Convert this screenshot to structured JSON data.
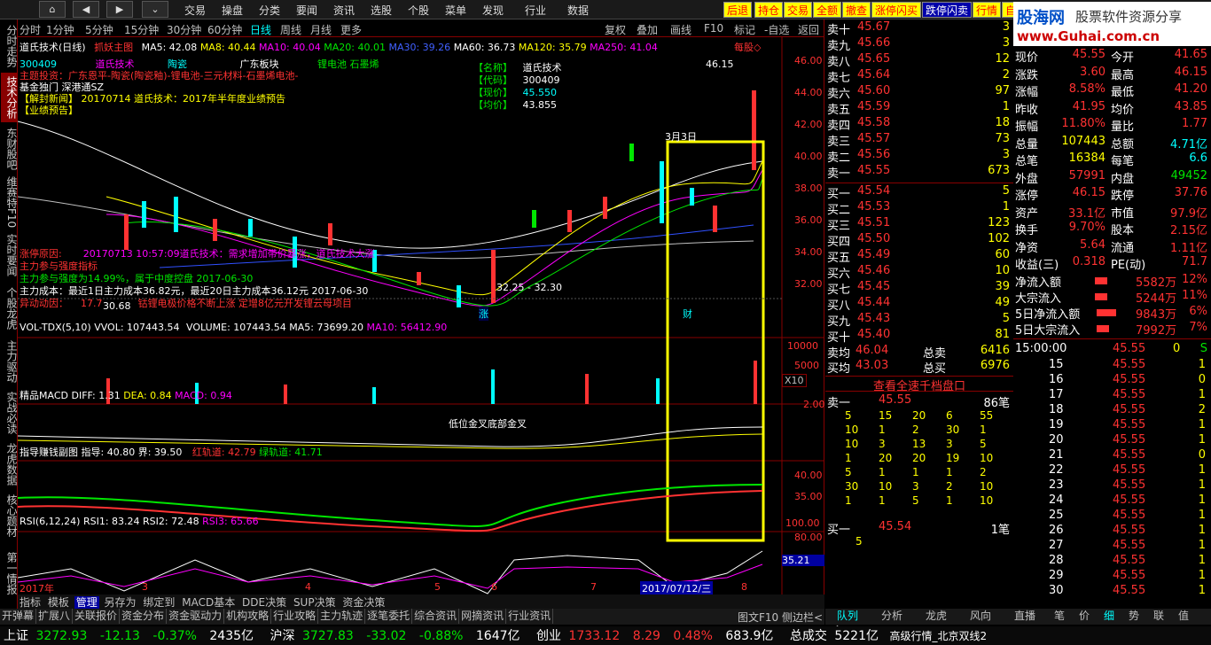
{
  "topbar": {
    "nav": [
      "⌂",
      "◀",
      "▶",
      "⌄"
    ],
    "menus": [
      "交易",
      "操盘",
      "分类",
      "要闻",
      "资讯",
      "选股",
      "个股",
      "菜单",
      "发现",
      "行业",
      "数据"
    ],
    "quick": [
      "后退",
      "持仓",
      "交易",
      "全额",
      "撤查",
      "涨停闪买",
      "跌停闪卖",
      "行情",
      "自"
    ]
  },
  "watermark": {
    "logo": "股海网",
    "slogan": "股票软件资源分享",
    "url": "www.Guhai.com.cn"
  },
  "lefttabs": [
    "分时走势",
    "技术分析",
    "东财股吧",
    "维赛特F10",
    "实时要闻",
    "个股龙虎",
    "主力驱动",
    "实战必读",
    "龙虎数据",
    "核心题材",
    "第一情报"
  ],
  "period": [
    "分时",
    "1分钟",
    "5分钟",
    "15分钟",
    "30分钟",
    "60分钟",
    "日线",
    "周线",
    "月线",
    "更多"
  ],
  "chart_toolbar": [
    "复权",
    "叠加",
    "画线",
    "F10",
    "标记",
    "-自选",
    "返回"
  ],
  "ma_line": {
    "name": "道氏技术(日线)",
    "tool": "抓妖主图",
    "ma5": "MA5: 42.08",
    "ma8": "MA8: 40.44",
    "ma10": "MA10: 40.04",
    "ma20": "MA20: 40.01",
    "ma30": "MA30: 39.26",
    "ma60": "MA60: 36.73",
    "ma120": "MA120: 35.79",
    "ma250": "MA250: 41.04",
    "right": "每股◇"
  },
  "info": {
    "code": "300409",
    "concept": "道氏技术",
    "c2": "陶瓷",
    "c3": "广东板块",
    "c4": "锂电池 石墨烯",
    "base": "基金独门 深港通SZ",
    "news": "【解封新闻】 20170714 道氏技术：2017年半年度业绩预告",
    "news2": "【业绩预告】",
    "l1": "主题投资：广东恩平-陶瓷(陶瓷釉)-锂电池-三元材料-石墨烯电池-"
  },
  "infobox": {
    "k1": "【名称】",
    "v1": "道氏技术",
    "k2": "【代码】",
    "v2": "300409",
    "k3": "【现价】",
    "v3": "45.550",
    "k4": "【均价】",
    "v4": "43.855"
  },
  "annot": {
    "high": "46.15",
    "date": "3月3日",
    "low": "32.25 - 32.30",
    "lowv": "30.68",
    "tag1": "涨",
    "tag2": "财",
    "reason": "涨停原因:",
    "reason2": "20170713 10:57:09道氏技术：需求增加带价暴涨，道氏技术大涨",
    "r3": "主力参与强度指标",
    "r4": "主力参与强度为14.99%，属于中度控盘 2017-06-30",
    "cost": "主力成本：",
    "cost2": "最近1日主力成本36.82元，最近20日主力成本36.12元 2017-06-30",
    "move": "异动动因：",
    "move2": "17.7",
    "move3": "钴锂电极价格不断上涨 定增8亿元开发锂云母项目"
  },
  "price_axis": [
    "46.00",
    "44.00",
    "42.00",
    "40.00",
    "38.00",
    "36.00",
    "34.00",
    "32.00"
  ],
  "vol": {
    "t": "VOL-TDX(5,10)",
    "a": "VVOL: 107443.54",
    "b": "VOLUME: 107443.54",
    "c": "MA5: 73699.20",
    "d": "MA10: 56412.90",
    "ax": [
      "10000",
      "5000"
    ],
    "x": "X10"
  },
  "macd": {
    "t": "精品MACD",
    "a": "DIFF: 1.31",
    "b": "DEA: 0.84",
    "c": "MACD: 0.94",
    "ax": "2.00",
    "note": "低位金叉底部金叉"
  },
  "zhidao": {
    "t": "指导赚钱副图",
    "a": "指导: 40.80",
    "b": "界: 39.50",
    "c": "红轨道: 42.79",
    "d": "绿轨道: 41.71",
    "ax": [
      "40.00",
      "35.00"
    ]
  },
  "rsi": {
    "t": "RSI(6,12,24)",
    "a": "RSI1: 83.24",
    "b": "RSI2: 72.48",
    "c": "RSI3: 65.66",
    "ax": [
      "100.00",
      "80.00"
    ],
    "cur": "35.21"
  },
  "months": [
    "2017年",
    "3",
    "4",
    "5",
    "6",
    "7",
    "8"
  ],
  "cursor_date": "2017/07/12/三",
  "bottom_tabs": [
    "指标",
    "模板",
    "管理",
    "另存为",
    "绑定到",
    "MACD基本",
    "DDE决策",
    "SUP决策",
    "资金决策"
  ],
  "bottom_tabs2": [
    "开弹幕",
    "扩展八",
    "关联报价",
    "资金分布",
    "资金驱动力",
    "机构攻略",
    "行业攻略",
    "主力轨迹",
    "逐笔委托",
    "综合资讯",
    "网摘资讯",
    "行业资讯"
  ],
  "bottom_right": [
    "图文F10",
    "侧边栏<"
  ],
  "right_tabs": [
    "队列",
    "分析",
    "龙虎",
    "风向",
    "直播",
    "笔",
    "价",
    "细",
    "势",
    "联",
    "值",
    "主"
  ],
  "asks": [
    [
      "卖十",
      "45.67",
      "3"
    ],
    [
      "卖九",
      "45.66",
      "3"
    ],
    [
      "卖八",
      "45.65",
      "12"
    ],
    [
      "卖七",
      "45.64",
      "2"
    ],
    [
      "卖六",
      "45.60",
      "97"
    ],
    [
      "卖五",
      "45.59",
      "1"
    ],
    [
      "卖四",
      "45.58",
      "18"
    ],
    [
      "卖三",
      "45.57",
      "73"
    ],
    [
      "卖二",
      "45.56",
      "3"
    ],
    [
      "卖一",
      "45.55",
      "673"
    ]
  ],
  "bids": [
    [
      "买一",
      "45.54",
      "5"
    ],
    [
      "买二",
      "45.53",
      "1"
    ],
    [
      "买三",
      "45.51",
      "123"
    ],
    [
      "买四",
      "45.50",
      "102"
    ],
    [
      "买五",
      "45.49",
      "60"
    ],
    [
      "买六",
      "45.46",
      "10"
    ],
    [
      "买七",
      "45.45",
      "39"
    ],
    [
      "买八",
      "45.44",
      "49"
    ],
    [
      "买九",
      "45.43",
      "5"
    ],
    [
      "买十",
      "45.40",
      "81"
    ]
  ],
  "avg": [
    [
      "卖均",
      "46.04",
      "总卖",
      "6416"
    ],
    [
      "买均",
      "43.03",
      "总买",
      "6976"
    ]
  ],
  "qianfan": "查看全速千档盘口",
  "sell1": {
    "l": "卖一",
    "p": "45.55",
    "n": "86笔"
  },
  "sell1_grid": [
    [
      "5",
      "15",
      "20",
      "6",
      "55"
    ],
    [
      "10",
      "1",
      "2",
      "30",
      "1"
    ],
    [
      "10",
      "3",
      "13",
      "3",
      "5"
    ],
    [
      "1",
      "20",
      "20",
      "19",
      "10"
    ],
    [
      "5",
      "1",
      "1",
      "1",
      "2"
    ],
    [
      "30",
      "10",
      "3",
      "2",
      "10"
    ],
    [
      "1",
      "1",
      "5",
      "1",
      "10"
    ]
  ],
  "buy1": {
    "l": "买一",
    "p": "45.54",
    "n": "1笔"
  },
  "buy1_grid": [
    "5"
  ],
  "quote": [
    [
      "现价",
      "45.55",
      "今开",
      "41.65"
    ],
    [
      "涨跌",
      "3.60",
      "最高",
      "46.15"
    ],
    [
      "涨幅",
      "8.58%",
      "最低",
      "41.20"
    ],
    [
      "昨收",
      "41.95",
      "均价",
      "43.85"
    ],
    [
      "振幅",
      "11.80%",
      "量比",
      "1.77"
    ],
    [
      "总量",
      "107443",
      "总额",
      "4.71亿"
    ],
    [
      "总笔",
      "16384",
      "每笔",
      "6.6"
    ],
    [
      "外盘",
      "57991",
      "内盘",
      "49452"
    ],
    [
      "涨停",
      "46.15",
      "跌停",
      "37.76"
    ],
    [
      "资产",
      "33.1亿",
      "市值",
      "97.9亿"
    ],
    [
      "换手",
      "9.70%",
      "股本",
      "2.15亿"
    ],
    [
      "净资",
      "5.64",
      "流通",
      "1.11亿"
    ],
    [
      "收益(三)",
      "0.318",
      "PE(动)",
      "71.7"
    ]
  ],
  "flows": [
    [
      "净流入额",
      "5582万",
      "12%"
    ],
    [
      "大宗流入",
      "5244万",
      "11%"
    ],
    [
      "5日净流入额",
      "9843万",
      "6%"
    ],
    [
      "5日大宗流入",
      "7992万",
      "7%"
    ]
  ],
  "ticks_head": {
    "t": "15:00:00",
    "p": "45.55",
    "v": "0",
    "s": "S"
  },
  "ticks": [
    [
      "15",
      "45.55",
      "1"
    ],
    [
      "16",
      "45.55",
      "0"
    ],
    [
      "17",
      "45.55",
      "1"
    ],
    [
      "18",
      "45.55",
      "2"
    ],
    [
      "19",
      "45.55",
      "1"
    ],
    [
      "20",
      "45.55",
      "1"
    ],
    [
      "21",
      "45.55",
      "0"
    ],
    [
      "22",
      "45.55",
      "1"
    ],
    [
      "23",
      "45.55",
      "1"
    ],
    [
      "24",
      "45.55",
      "1"
    ],
    [
      "25",
      "45.55",
      "1"
    ],
    [
      "26",
      "45.55",
      "1"
    ],
    [
      "27",
      "45.55",
      "1"
    ],
    [
      "28",
      "45.55",
      "1"
    ],
    [
      "29",
      "45.55",
      "1"
    ],
    [
      "30",
      "45.55",
      "1"
    ]
  ],
  "status": {
    "sh_l": "上证",
    "sh": "3272.93",
    "sh_c": "-12.13",
    "sh_p": "-0.37%",
    "sh_v": "2435亿",
    "hs_l": "沪深",
    "hs": "3727.83",
    "hs_c": "-33.02",
    "hs_p": "-0.88%",
    "hs_v": "1647亿",
    "cy_l": "创业",
    "cy": "1733.12",
    "cy_c": "8.29",
    "cy_p": "0.48%",
    "cy_v": "683.9亿",
    "tot_l": "总成交",
    "tot": "5221亿",
    "src": "高级行情_北京双线2"
  }
}
